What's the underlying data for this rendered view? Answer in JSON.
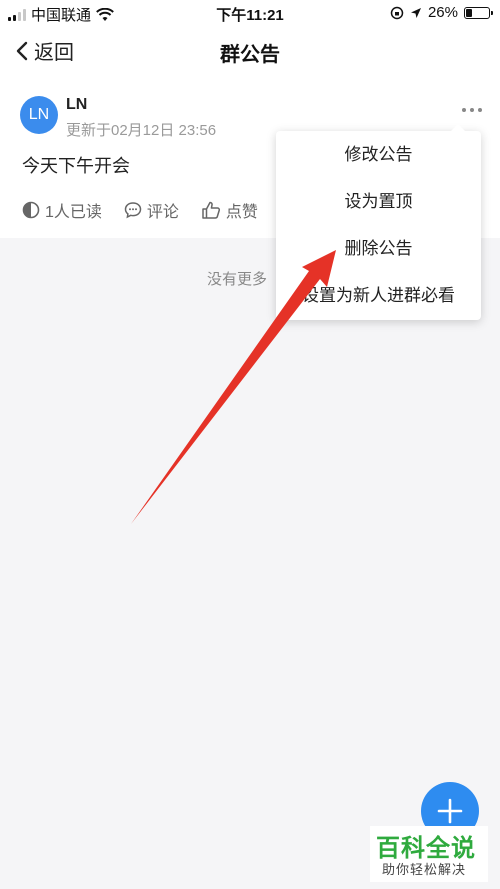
{
  "status_bar": {
    "carrier": "中国联通",
    "time": "下午11:21",
    "battery": "26%"
  },
  "nav": {
    "back_label": "返回",
    "title": "群公告"
  },
  "announcement": {
    "avatar_text": "LN",
    "author": "LN",
    "updated": "更新于02月12日 23:56",
    "content": "今天下午开会",
    "read_label": "1人已读",
    "comment_label": "评论",
    "like_label": "点赞"
  },
  "list_end": "没有更多",
  "menu": {
    "items": [
      {
        "label": "修改公告"
      },
      {
        "label": "设为置顶"
      },
      {
        "label": "删除公告"
      },
      {
        "label": "设置为新人进群必看"
      }
    ]
  },
  "watermark": {
    "main": "百科全说",
    "sub": "助你轻松解决"
  },
  "colors": {
    "accent": "#2e8cf0",
    "avatar": "#3b8ced",
    "arrow": "#e53227",
    "watermark_green": "#2faa3e"
  },
  "icons": {
    "read": "half-circle-icon",
    "comment": "comment-bubble-icon",
    "like": "thumbs-up-icon",
    "more": "more-dots-icon",
    "fab": "plus-icon"
  }
}
